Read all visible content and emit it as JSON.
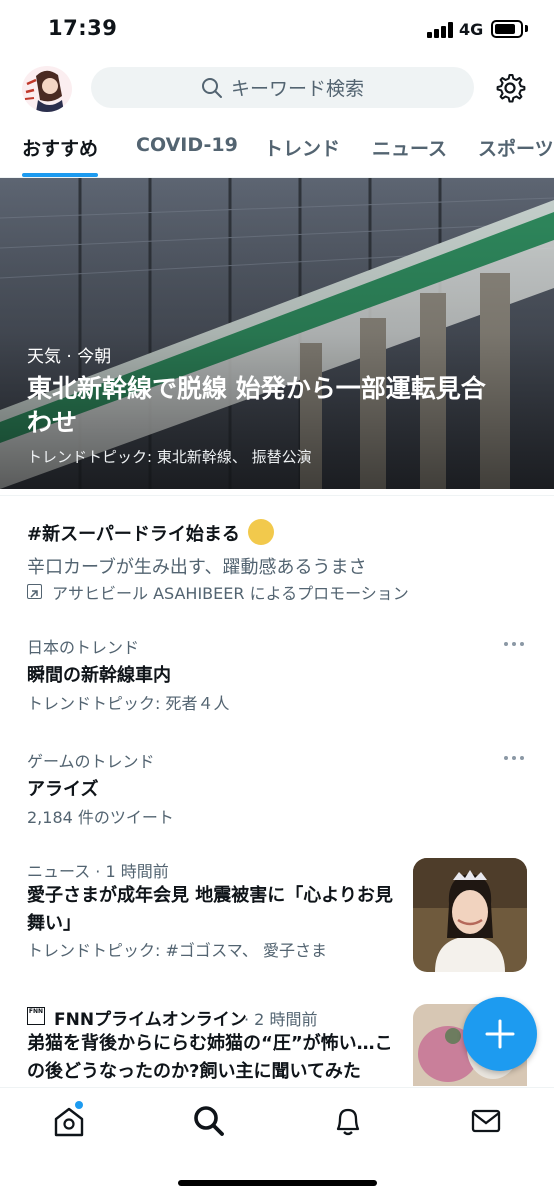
{
  "status_bar": {
    "time": "17:39",
    "network": "4G"
  },
  "header": {
    "search_placeholder": "キーワード検索",
    "icons": {
      "search": "search-icon",
      "settings": "gear-icon"
    }
  },
  "tabs": [
    {
      "label": "おすすめ",
      "active": true
    },
    {
      "label": "COVID-19",
      "active": false
    },
    {
      "label": "トレンド",
      "active": false
    },
    {
      "label": "ニュース",
      "active": false
    },
    {
      "label": "スポーツ",
      "active": false
    }
  ],
  "hero": {
    "category": "天気 · 今朝",
    "title": "東北新幹線で脱線 始発から一部運転見合わせ",
    "topic": "トレンドトピック: 東北新幹線、 振替公演"
  },
  "promo": {
    "title": "#新スーパードライ始まる",
    "description": "辛口カーブが生み出す、躍動感あるうまさ",
    "promoted_by": "アサヒビール ASAHIBEER によるプロモーション"
  },
  "trends": [
    {
      "category": "日本のトレンド",
      "name": "瞬間の新幹線車内",
      "sub": "トレンドトピック: 死者４人"
    },
    {
      "category": "ゲームのトレンド",
      "name": "アライズ",
      "sub": "2,184 件のツイート"
    }
  ],
  "news": [
    {
      "meta": "ニュース · 1 時間前",
      "title": "愛子さまが成年会見 地震被害に「心よりお見舞い」",
      "sub": "トレンドトピック: #ゴゴスマ、 愛子さま"
    },
    {
      "source": "FNNプライムオンライン",
      "meta": "· 2 時間前",
      "title": "弟猫を背後からにらむ姉猫の“圧”が怖い…この後どうなったのか?飼い主に聞いてみた",
      "logo_text": "FNN"
    }
  ],
  "colors": {
    "accent": "#1d9bf0",
    "text": "#0f1419",
    "secondary": "#536471"
  },
  "bottom_nav": [
    "home-icon",
    "search-icon",
    "bell-icon",
    "mail-icon"
  ]
}
